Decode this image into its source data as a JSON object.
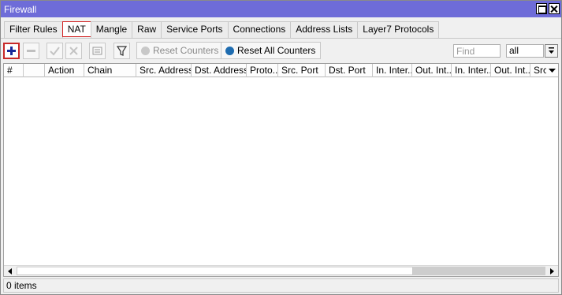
{
  "window": {
    "title": "Firewall"
  },
  "tabs": [
    {
      "label": "Filter Rules",
      "active": false
    },
    {
      "label": "NAT",
      "active": true
    },
    {
      "label": "Mangle",
      "active": false
    },
    {
      "label": "Raw",
      "active": false
    },
    {
      "label": "Service Ports",
      "active": false
    },
    {
      "label": "Connections",
      "active": false
    },
    {
      "label": "Address Lists",
      "active": false
    },
    {
      "label": "Layer7 Protocols",
      "active": false
    }
  ],
  "toolbar": {
    "icons": [
      "add-icon",
      "remove-icon",
      "enable-icon",
      "disable-icon",
      "comment-icon",
      "filter-icon"
    ],
    "reset_counters": "Reset Counters",
    "reset_all_counters": "Reset All Counters",
    "find_placeholder": "Find",
    "filter_value": "all"
  },
  "table": {
    "columns": [
      "#",
      "",
      "Action",
      "Chain",
      "Src. Address",
      "Dst. Address",
      "Proto...",
      "Src. Port",
      "Dst. Port",
      "In. Inter...",
      "Out. Int...",
      "In. Inter...",
      "Out. Int...",
      "Src."
    ],
    "rows": []
  },
  "status": {
    "items": "0 items"
  },
  "colors": {
    "titlebar": "#6e6cd8",
    "active_tab_border": "#d02020",
    "add_icon": "#1a2a9a",
    "reset_all_icon": "#1e6cb0"
  }
}
